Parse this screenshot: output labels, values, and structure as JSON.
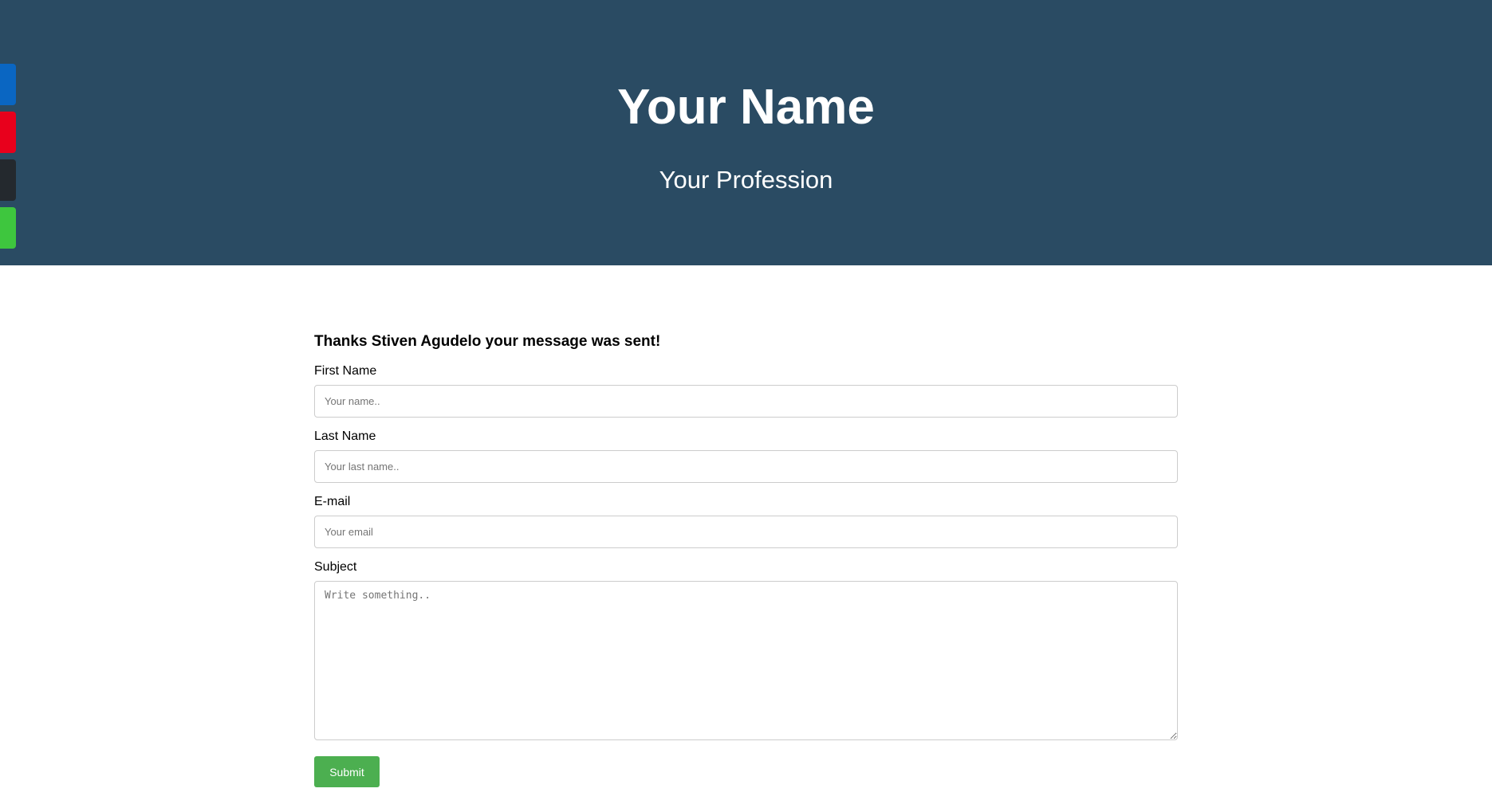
{
  "header": {
    "name": "Your Name",
    "profession": "Your Profession",
    "background_color": "#2a4b63"
  },
  "social_tabs": [
    {
      "icon": "blue-social-tab",
      "color": "#0a66c2"
    },
    {
      "icon": "red-social-tab",
      "color": "#e8001c"
    },
    {
      "icon": "dark-social-tab",
      "color": "#24292e"
    },
    {
      "icon": "green-social-tab",
      "color": "#3ec63e"
    }
  ],
  "contact_form": {
    "confirmation": "Thanks Stiven Agudelo your message was sent!",
    "first_name": {
      "label": "First Name",
      "placeholder": "Your name..",
      "value": ""
    },
    "last_name": {
      "label": "Last Name",
      "placeholder": "Your last name..",
      "value": ""
    },
    "email": {
      "label": "E-mail",
      "placeholder": "Your email",
      "value": ""
    },
    "subject": {
      "label": "Subject",
      "placeholder": "Write something..",
      "value": ""
    },
    "submit_label": "Submit",
    "submit_color": "#4caf50"
  }
}
